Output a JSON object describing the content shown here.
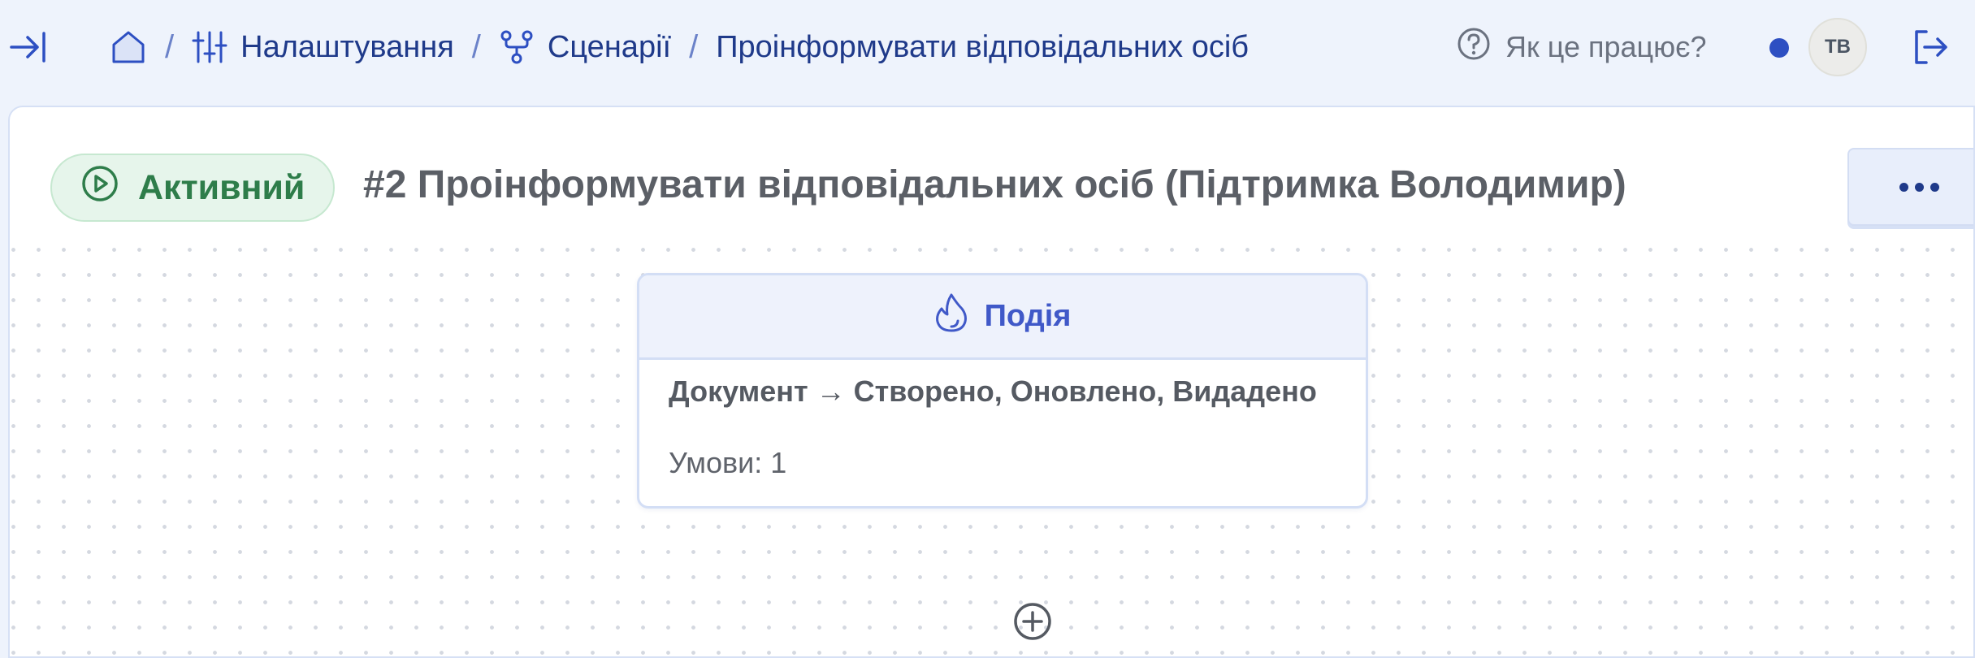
{
  "header": {
    "breadcrumb": {
      "settings_label": "Налаштування",
      "scenarios_label": "Сценарії",
      "current_label": "Проінформувати відповідальних осіб",
      "separator": "/"
    },
    "help_label": "Як це працює?",
    "avatar_initials": "ТВ"
  },
  "scenario": {
    "status_label": "Активний",
    "title": "#2 Проінформувати відповідальних осіб (Підтримка Володимир)"
  },
  "event_card": {
    "header_label": "Подія",
    "trigger": "Документ → Створено, Оновлено, Видадено",
    "conditions": "Умови: 1"
  },
  "icons": {
    "collapse": "sidebar-expand-icon",
    "home": "home-icon",
    "settings": "sliders-icon",
    "scenarios": "branch-flow-icon",
    "help": "question-circle-icon",
    "logout": "logout-icon",
    "status": "play-circle-icon",
    "event": "flame-icon",
    "more": "more-horizontal-icon",
    "add": "plus-circle-icon"
  },
  "colors": {
    "accent": "#1f3a8a",
    "active_green": "#2e7d4a",
    "event_blue": "#4059c8",
    "background": "#eef3fc"
  }
}
